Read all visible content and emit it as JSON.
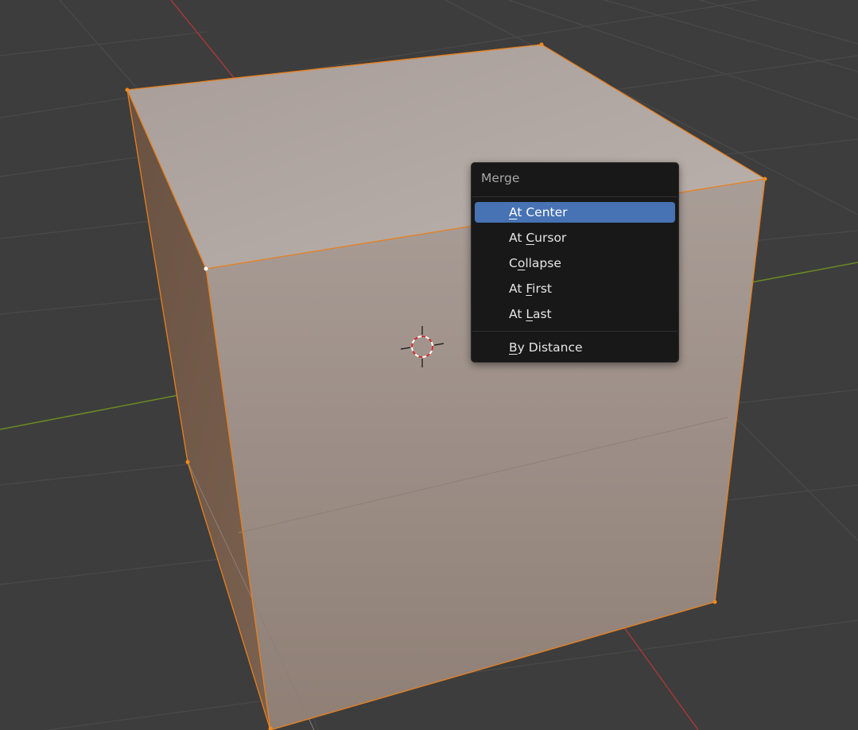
{
  "viewport": {
    "colors": {
      "background": "#3d3d3d",
      "grid": "#4a4a4a",
      "x_axis": "#a3393a",
      "y_axis": "#6a8a24",
      "edge_selected": "#e8801e",
      "top_face": "#b3a8a3",
      "front_face": "#a39690",
      "side_face": "#6d5646"
    },
    "cursor_icon": "3d-cursor-icon"
  },
  "menu": {
    "title": "Merge",
    "items": [
      {
        "pre": "",
        "key": "A",
        "post": "t Center",
        "active": true
      },
      {
        "pre": "At ",
        "key": "C",
        "post": "ursor",
        "active": false
      },
      {
        "pre": "C",
        "key": "o",
        "post": "llapse",
        "active": false
      },
      {
        "pre": "At ",
        "key": "F",
        "post": "irst",
        "active": false
      },
      {
        "pre": "At ",
        "key": "L",
        "post": "ast",
        "active": false
      },
      {
        "pre": "",
        "key": "B",
        "post": "y Distance",
        "active": false
      }
    ],
    "colors": {
      "background": "#181818",
      "highlight": "#4772b3",
      "text": "#e6e6e6",
      "title": "#a8a8a8"
    }
  }
}
